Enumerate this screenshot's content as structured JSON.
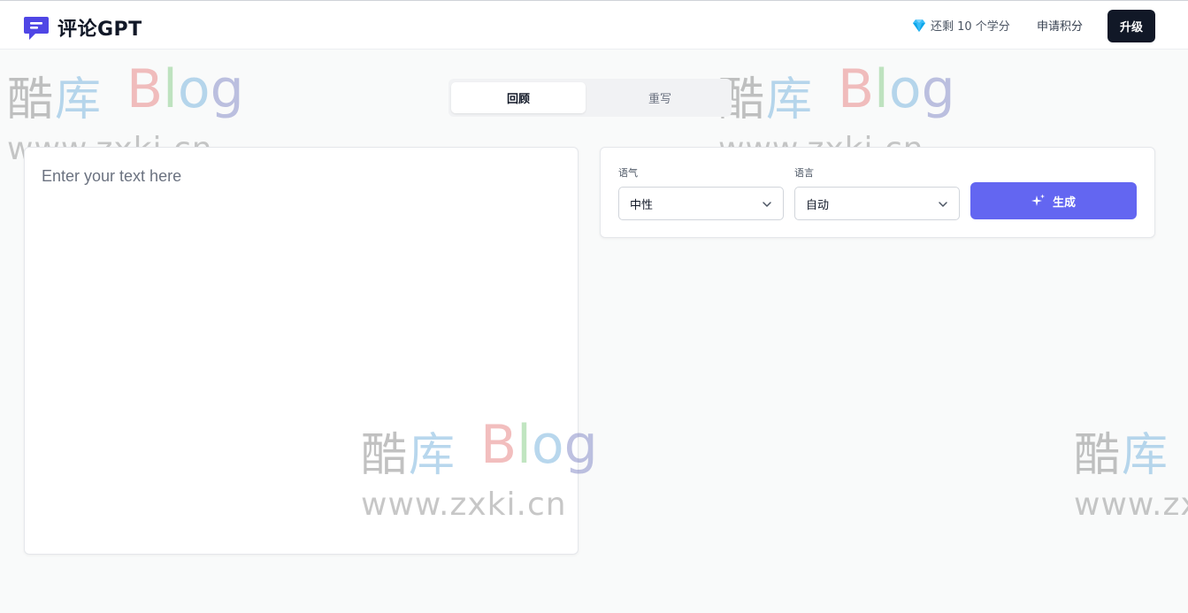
{
  "app": {
    "title": "评论GPT"
  },
  "header": {
    "credits_text": "还剩 10 个学分",
    "apply_label": "申请积分",
    "upgrade_label": "升级"
  },
  "tabs": [
    {
      "label": "回顾",
      "active": true
    },
    {
      "label": "重写",
      "active": false
    }
  ],
  "editor": {
    "placeholder": "Enter your text here",
    "value": ""
  },
  "controls": {
    "tone": {
      "label": "语气",
      "value": "中性"
    },
    "language": {
      "label": "语言",
      "value": "自动"
    },
    "generate_label": "生成"
  },
  "watermark": {
    "chars": [
      "酷",
      "库"
    ],
    "blog": [
      "B",
      "l",
      "o",
      "g"
    ],
    "url": "www.zxki.cn"
  },
  "colors": {
    "accent": "#6366f1",
    "dark_button": "#111827",
    "background": "#f9fafa",
    "logo": "#4f46e5"
  },
  "icons": {
    "logo": "chat-bubble-icon",
    "credits": "diamond-icon",
    "generate": "sparkle-icon",
    "select": "chevron-down-icon"
  }
}
